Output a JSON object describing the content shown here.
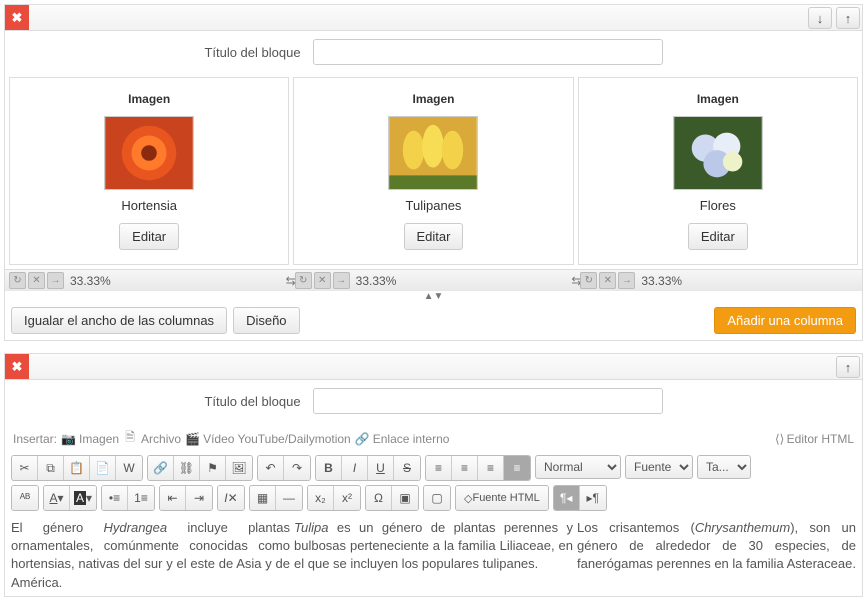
{
  "title_label": "Título del bloque",
  "title_value": "",
  "cols": [
    {
      "header": "Imagen",
      "caption": "Hortensia",
      "edit": "Editar",
      "width": "33.33%"
    },
    {
      "header": "Imagen",
      "caption": "Tulipanes",
      "edit": "Editar",
      "width": "33.33%"
    },
    {
      "header": "Imagen",
      "caption": "Flores",
      "edit": "Editar",
      "width": "33.33%"
    }
  ],
  "btn_equal": "Igualar el ancho de las columnas",
  "btn_design": "Diseño",
  "btn_add": "Añadir una columna",
  "title_label2": "Título del bloque",
  "title_value2": "",
  "ins_label": "Insertar:",
  "ins_image": "Imagen",
  "ins_file": "Archivo",
  "ins_video": "Vídeo YouTube/Dailymotion",
  "ins_link": "Enlace interno",
  "ins_html": "Editor HTML",
  "sel_format": "Normal",
  "sel_font": "Fuente",
  "sel_size": "Ta...",
  "btn_src": "Fuente HTML",
  "body1a": "El género ",
  "body1i": "Hydrangea",
  "body1b": " incluye plantas ornamentales, comúnmente conocidas como hortensias, nativas del sur y el este de Asia y de América.",
  "body2i": "Tulipa",
  "body2": " es un género de plantas perennes y bulbosas perteneciente a la familia Liliaceae, en el que se incluyen los populares tulipanes.",
  "body3a": "Los crisantemos (",
  "body3i": "Chrysanthemum",
  "body3b": "), son un género de alrededor de 30 especies, de fanerógamas perennes en la familia Asteraceae."
}
